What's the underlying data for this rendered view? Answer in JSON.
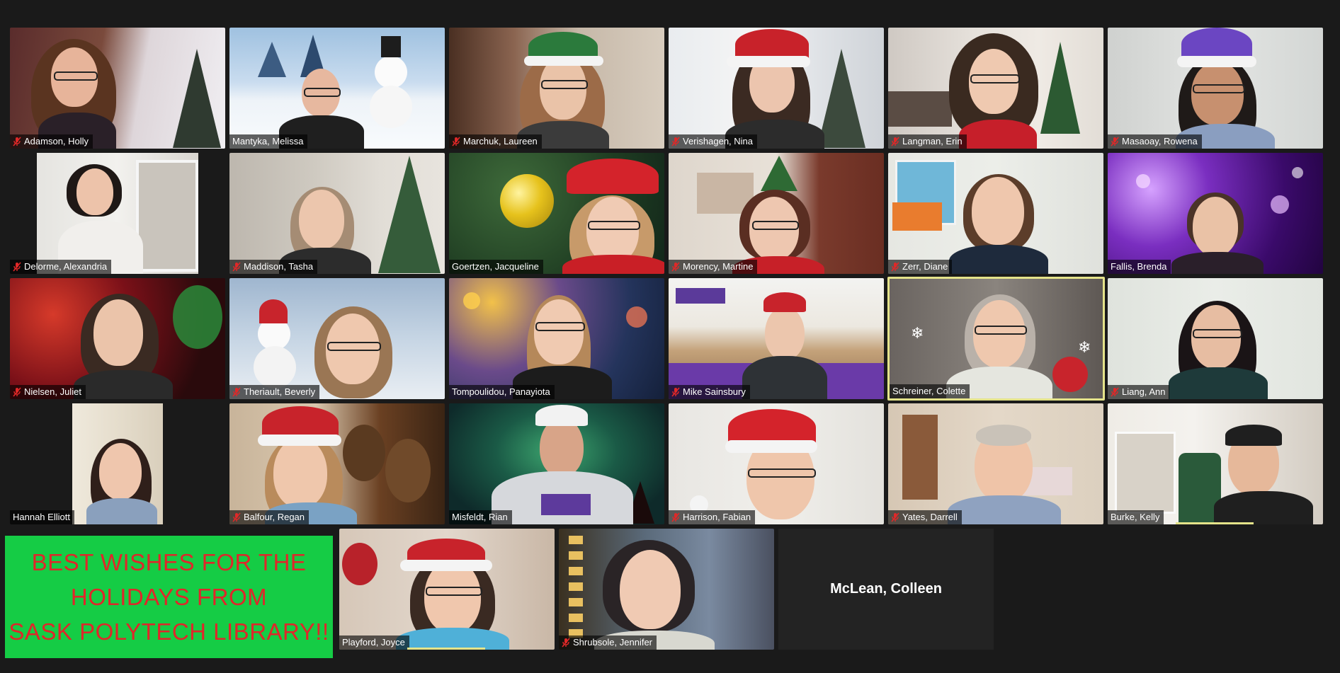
{
  "colors": {
    "background": "#1a1a1a",
    "active_speaker_border": "#e4e38a",
    "mute_icon": "#e02828",
    "banner_background": "#15cc45",
    "banner_text": "#e0262a"
  },
  "tiles": [
    {
      "name": "Adamson, Holly",
      "muted": true
    },
    {
      "name": "Mantyka, Melissa",
      "muted": false
    },
    {
      "name": "Marchuk, Laureen",
      "muted": true
    },
    {
      "name": "Verishagen, Nina",
      "muted": true
    },
    {
      "name": "Langman, Erin",
      "muted": true
    },
    {
      "name": "Masaoay, Rowena",
      "muted": true
    },
    {
      "name": "Delorme, Alexandria",
      "muted": true
    },
    {
      "name": "Maddison, Tasha",
      "muted": true
    },
    {
      "name": "Goertzen, Jacqueline",
      "muted": false
    },
    {
      "name": "Morency, Martine",
      "muted": true
    },
    {
      "name": "Zerr, Diane",
      "muted": true
    },
    {
      "name": "Fallis, Brenda",
      "muted": false
    },
    {
      "name": "Nielsen, Juliet",
      "muted": true
    },
    {
      "name": "Theriault, Beverly",
      "muted": true
    },
    {
      "name": "Tompoulidou, Panayiota",
      "muted": false
    },
    {
      "name": "Mike Sainsbury",
      "muted": true
    },
    {
      "name": "Schreiner, Colette",
      "muted": false,
      "speaking": true
    },
    {
      "name": "Liang, Ann",
      "muted": true
    },
    {
      "name": "Hannah Elliott",
      "muted": false
    },
    {
      "name": "Balfour, Regan",
      "muted": true
    },
    {
      "name": "Misfeldt, Rian",
      "muted": false
    },
    {
      "name": "Harrison, Fabian",
      "muted": true
    },
    {
      "name": "Yates, Darrell",
      "muted": true
    },
    {
      "name": "Burke, Kelly",
      "muted": false
    },
    {
      "name": "Playford, Joyce",
      "muted": false
    },
    {
      "name": "Shrubsole, Jennifer",
      "muted": true
    }
  ],
  "banner": {
    "line1": "BEST WISHES FOR THE",
    "line2": "HOLIDAYS FROM",
    "line3": "SASK POLYTECH LIBRARY!!"
  },
  "video_off_tile": {
    "name": "McLean, Colleen"
  },
  "icons": {
    "mute": "microphone-muted-icon"
  }
}
